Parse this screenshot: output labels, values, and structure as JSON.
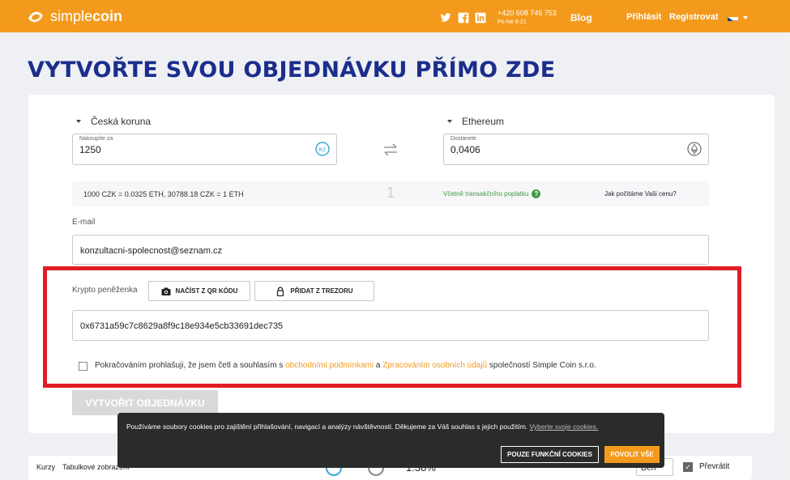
{
  "header": {
    "logo_light": "simple",
    "logo_bold": "coin",
    "phone": "+420 608 746 753",
    "hours": "Po-Ne 9-21",
    "blog": "Blog",
    "login": "Přihlásit",
    "register": "Registrovat",
    "social_icons": [
      "twitter-icon",
      "facebook-icon",
      "linkedin-icon"
    ],
    "accent": "#f39a1c"
  },
  "page_title": "VYTVOŘTE SVOU OBJEDNÁVKU PŘÍMO ZDE",
  "exchange": {
    "from_currency": "Česká koruna",
    "from_label": "Nakoupíte za",
    "from_value": "1250",
    "to_currency": "Ethereum",
    "to_label": "Dostanete",
    "to_value": "0,0406"
  },
  "rate": {
    "text": "1000 CZK = 0.0325 ETH, 30788.18 CZK = 1 ETH",
    "step": "1",
    "fee": "Včetně transakčního poplatku",
    "how": "Jak počítáme Vaši cenu?"
  },
  "email": {
    "label": "E-mail",
    "value": "konzultacni-spolecnost@seznam.cz"
  },
  "wallet": {
    "label": "Krypto peněženka",
    "qr_button": "NAČÍST Z QR KÓDU",
    "trezor_button": "PŘIDAT Z TREZORU",
    "value": "0x6731a59c7c8629a8f9c18e934e5cb33691dec735"
  },
  "terms": {
    "prefix": "Pokračováním prohlašuji, že jsem četl a souhlasím s ",
    "link1": "obchodními podmínkami",
    "middle": " a ",
    "link2": "Zpracováním osobních údajů",
    "suffix": " společností Simple Coin s.r.o."
  },
  "submit": "VYTVOŘIT OBJEDNÁVKU",
  "bottom": {
    "kurzy": "Kurzy",
    "tab": "Tabulkové zobrazení",
    "percent": "1.38%",
    "period": "Den",
    "invert": "Převrátit"
  },
  "cookie": {
    "text": "Používáme soubory cookies pro zajištění přihlašování, navigací a analýzy návštěvnosti. Děkujeme za Váš souhlas s jejich použitím. ",
    "link": "Vyberte svoje cookies.",
    "btn_functional": "POUZE FUNKČNÍ COOKIES",
    "btn_allow": "POVOLIT VŠE"
  }
}
